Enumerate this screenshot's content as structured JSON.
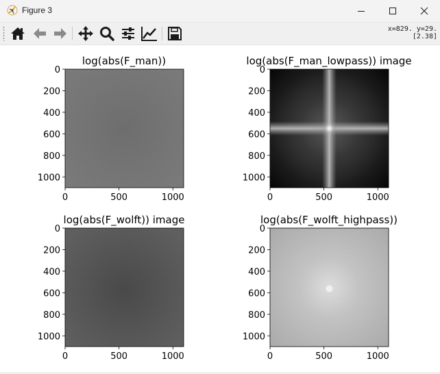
{
  "window": {
    "title": "Figure 3",
    "controls": {
      "minimize": "minimize",
      "maximize": "maximize",
      "close": "close"
    }
  },
  "toolbar": {
    "buttons": [
      {
        "name": "home",
        "icon": "home-icon"
      },
      {
        "name": "back",
        "icon": "arrow-left-icon"
      },
      {
        "name": "forward",
        "icon": "arrow-right-icon"
      },
      {
        "name": "pan",
        "icon": "move-icon"
      },
      {
        "name": "zoom",
        "icon": "magnifier-icon"
      },
      {
        "name": "subplots",
        "icon": "sliders-icon"
      },
      {
        "name": "edit-axes",
        "icon": "chart-line-icon"
      },
      {
        "name": "save",
        "icon": "floppy-icon"
      }
    ],
    "coords_line1": "x=829. y=29.",
    "coords_line2": "[2.38]"
  },
  "chart_data": [
    {
      "type": "heatmap",
      "title": "log(abs(F_man))",
      "xticks": [
        "0",
        "500",
        "1000"
      ],
      "yticks": [
        "0",
        "200",
        "400",
        "600",
        "800",
        "1000"
      ],
      "xlim": [
        0,
        1100
      ],
      "ylim": [
        1100,
        0
      ],
      "colormap": "gray",
      "appearance": "uniform mid-gray spectrum"
    },
    {
      "type": "heatmap",
      "title": "log(abs(F_man_lowpass)) image",
      "xticks": [
        "0",
        "500",
        "1000"
      ],
      "yticks": [
        "0",
        "200",
        "400",
        "600",
        "800",
        "1000"
      ],
      "xlim": [
        0,
        1100
      ],
      "ylim": [
        1100,
        0
      ],
      "colormap": "gray",
      "appearance": "black background with bright cross through center (550, 550)"
    },
    {
      "type": "heatmap",
      "title": "log(abs(F_wolft)) image",
      "xticks": [
        "0",
        "500",
        "1000"
      ],
      "yticks": [
        "0",
        "200",
        "400",
        "600",
        "800",
        "1000"
      ],
      "xlim": [
        0,
        1100
      ],
      "ylim": [
        1100,
        0
      ],
      "colormap": "gray",
      "appearance": "dark gray spectrum, slightly darker at center"
    },
    {
      "type": "heatmap",
      "title": "log(abs(F_wolft_highpass))",
      "xticks": [
        "0",
        "500",
        "1000"
      ],
      "yticks": [
        "0",
        "200",
        "400",
        "600",
        "800",
        "1000"
      ],
      "xlim": [
        0,
        1100
      ],
      "ylim": [
        1100,
        0
      ],
      "colormap": "gray",
      "appearance": "light gray with bright center near (550, 550)"
    }
  ],
  "colors": {
    "titlebar": "#f3f3f3",
    "toolbar": "#f0f0f0",
    "icon": "#1a1a1a"
  }
}
